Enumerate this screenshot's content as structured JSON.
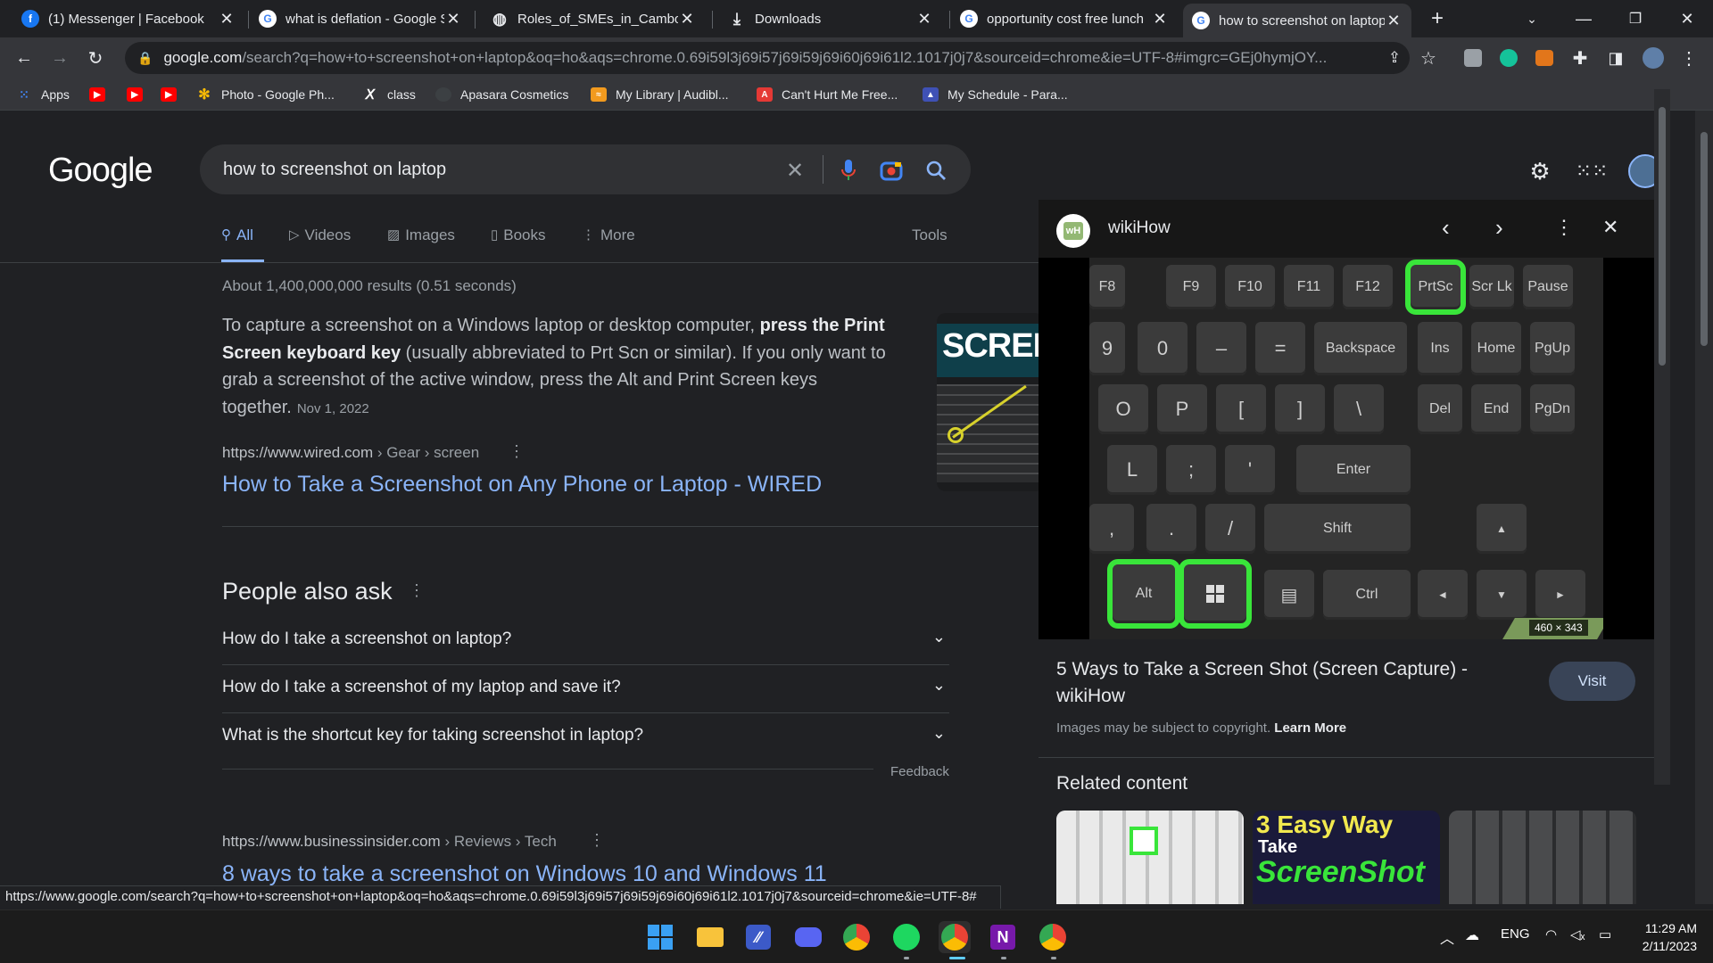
{
  "tabs": [
    {
      "title": "(1) Messenger | Facebook",
      "favicon": "facebook-icon",
      "color": "#1877f2",
      "glyph": "f"
    },
    {
      "title": "what is deflation - Google Search",
      "favicon": "google-icon",
      "color": "#e8eaed",
      "glyph": "G"
    },
    {
      "title": "Roles_of_SMEs_in_Cambodia",
      "favicon": "globe-icon",
      "color": "#e8eaed",
      "glyph": "◍"
    },
    {
      "title": "Downloads",
      "favicon": "download-icon",
      "color": "#e8eaed",
      "glyph": "⤓"
    },
    {
      "title": "opportunity cost free lunch",
      "favicon": "google-icon",
      "color": "#e8eaed",
      "glyph": "G"
    },
    {
      "title": "how to screenshot on laptop",
      "favicon": "google-icon",
      "color": "#e8eaed",
      "glyph": "G"
    }
  ],
  "omnibox": {
    "domain": "google.com",
    "rest": "/search?q=how+to+screenshot+on+laptop&oq=ho&aqs=chrome.0.69i59l3j69i57j69i59j69i60j69i61l2.1017j0j7&sourceid=chrome&ie=UTF-8#imgrc=GEj0hymjOY..."
  },
  "bookmarks": [
    {
      "label": "Apps",
      "icon": "apps-grid-icon",
      "color": "#4285f4"
    },
    {
      "label": "",
      "icon": "youtube-icon",
      "color": "#ff0000"
    },
    {
      "label": "",
      "icon": "youtube-icon",
      "color": "#ff0000"
    },
    {
      "label": "",
      "icon": "youtube-icon",
      "color": "#ff0000"
    },
    {
      "label": "Photo - Google Ph...",
      "icon": "google-photos-icon",
      "color": "#fbbc04"
    },
    {
      "label": "class",
      "icon": "x-icon",
      "color": "#ffffff"
    },
    {
      "label": "Apasara Cosmetics",
      "icon": "globe-icon",
      "color": "#3c4043"
    },
    {
      "label": "My Library | Audibl...",
      "icon": "audible-icon",
      "color": "#f29a1e"
    },
    {
      "label": "Can't Hurt Me Free...",
      "icon": "pdf-icon",
      "color": "#e53935"
    },
    {
      "label": "My Schedule - Para...",
      "icon": "para-icon",
      "color": "#3f51b5"
    }
  ],
  "search": {
    "logo": "Google",
    "query": "how to screenshot on laptop"
  },
  "navtabs": {
    "all": "All",
    "videos": "Videos",
    "images": "Images",
    "books": "Books",
    "more": "More",
    "tools": "Tools"
  },
  "results": {
    "stats": "About 1,400,000,000 results (0.51 seconds)",
    "snippet_pre": "To capture a screenshot on a Windows laptop or desktop computer, ",
    "snippet_bold": "press the Print Screen keyboard key",
    "snippet_post": " (usually abbreviated to Prt Scn or similar). If you only want to grab a screenshot of the active window, press the Alt and Print Screen keys together.",
    "snippet_date": "Nov 1, 2022",
    "thumb_text": "SCREE",
    "first_cite": "https://www.wired.com",
    "first_cite_path": " › Gear › screen",
    "first_title": "How to Take a Screenshot on Any Phone or Laptop - WIRED",
    "second_cite": "https://www.businessinsider.com",
    "second_cite_path": " › Reviews › Tech",
    "second_title": "8 ways to take a screenshot on Windows 10 and Windows 11"
  },
  "paa": {
    "title": "People also ask",
    "questions": [
      "How do I take a screenshot on laptop?",
      "How do I take a screenshot of my laptop and save it?",
      "What is the shortcut key for taking screenshot in laptop?"
    ],
    "feedback": "Feedback"
  },
  "panel": {
    "source": "wikiHow",
    "source_logo": "wH",
    "dims": "460 × 343",
    "title": "5 Ways to Take a Screen Shot (Screen Capture) - wikiHow",
    "visit": "Visit",
    "copyright": "Images may be subject to copyright.",
    "learn_more": "Learn More",
    "related": "Related content",
    "related2_line1": "3 Easy Way",
    "related2_line2": "Take",
    "related2_line3": "ScreenShot",
    "keys": {
      "f8": "F8",
      "f9": "F9",
      "f10": "F10",
      "f11": "F11",
      "f12": "F12",
      "prtsc": "PrtSc",
      "scrlk": "Scr Lk",
      "pause": "Pause",
      "nine": "9",
      "zero": "0",
      "minus": "–",
      "equals": "=",
      "backspace": "Backspace",
      "ins": "Ins",
      "home": "Home",
      "pgup": "PgUp",
      "o": "O",
      "p": "P",
      "lbracket": "[",
      "rbracket": "]",
      "backslash": "\\",
      "del": "Del",
      "end": "End",
      "pgdn": "PgDn",
      "l": "L",
      "semicolon": ";",
      "quote": "'",
      "enter": "Enter",
      "comma": ",",
      "period": ".",
      "slash": "/",
      "shift": "Shift",
      "up": "▲",
      "alt": "Alt",
      "menu": "▤",
      "ctrl": "Ctrl",
      "left": "◄",
      "down": "▼",
      "right": "►"
    }
  },
  "statusbar": "https://www.google.com/search?q=how+to+screenshot+on+laptop&oq=ho&aqs=chrome.0.69i59l3j69i57j69i59j69i60j69i61l2.1017j0j7&sourceid=chrome&ie=UTF-8#",
  "taskbar": {
    "lang": "ENG",
    "time": "11:29 AM",
    "date": "2/11/2023"
  },
  "colors": {
    "link": "#8ab4f8",
    "highlight": "#39e53a",
    "background": "#202124"
  }
}
